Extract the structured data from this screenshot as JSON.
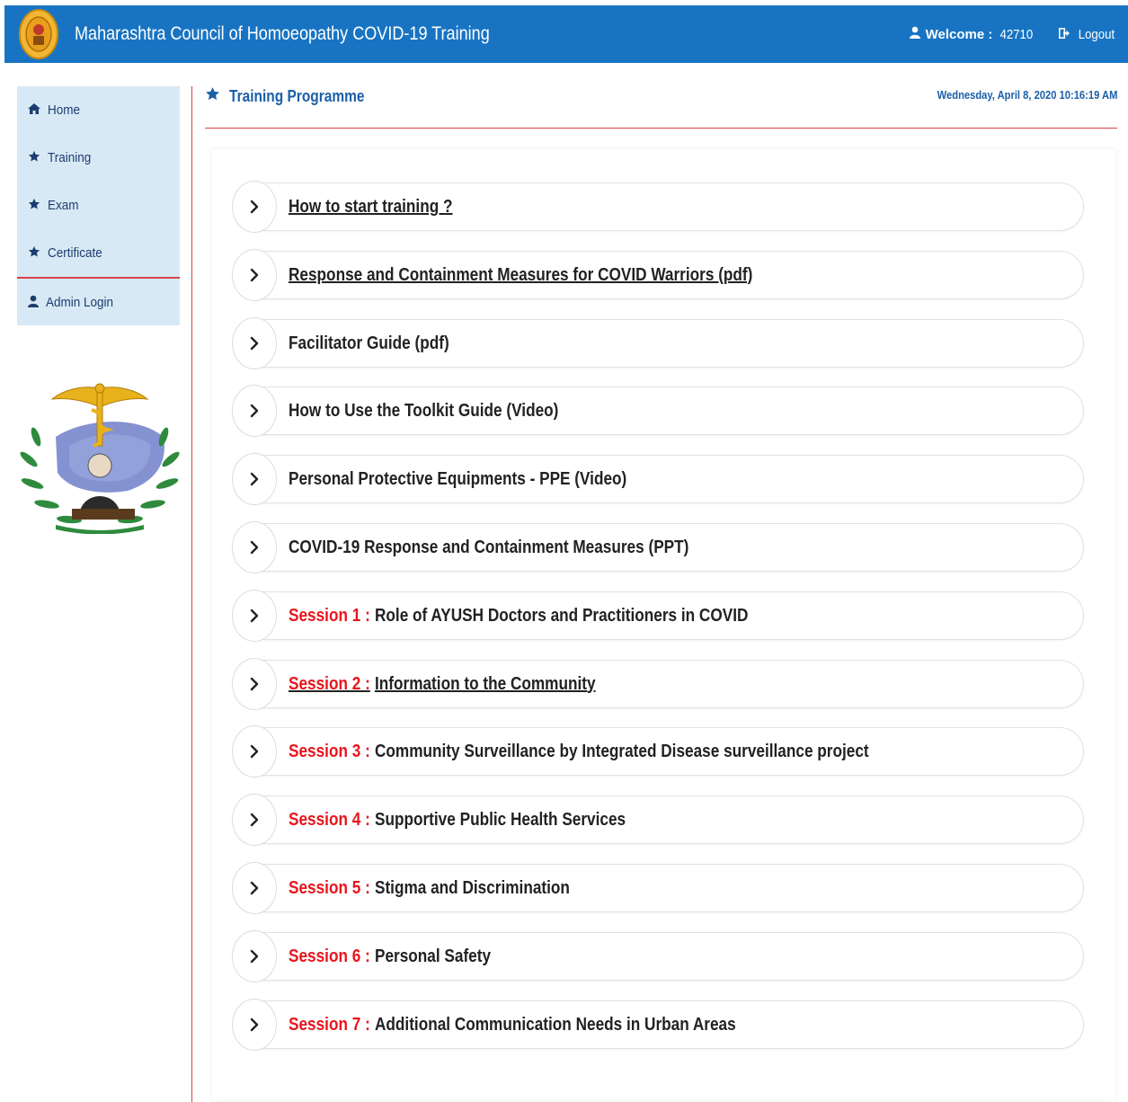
{
  "header": {
    "title": "Maharashtra Council of Homoeopathy COVID-19 Training",
    "welcome_label": "Welcome :",
    "welcome_value": "42710",
    "logout_label": "Logout"
  },
  "sidebar": {
    "items": [
      {
        "label": "Home",
        "icon": "home-icon"
      },
      {
        "label": "Training",
        "icon": "star-icon"
      },
      {
        "label": "Exam",
        "icon": "star-icon"
      },
      {
        "label": "Certificate",
        "icon": "star-icon"
      },
      {
        "label": "Admin Login",
        "icon": "user-icon"
      }
    ]
  },
  "page": {
    "title": "Training Programme",
    "datetime": "Wednesday, April 8, 2020 10:16:19 AM"
  },
  "programme": [
    {
      "session": "",
      "label": "How to start training ?"
    },
    {
      "session": "",
      "label": "Response and Containment Measures for COVID Warriors (pdf)"
    },
    {
      "session": "",
      "label": "Facilitator Guide (pdf)"
    },
    {
      "session": "",
      "label": "How to Use the Toolkit Guide (Video)"
    },
    {
      "session": "",
      "label": "Personal Protective Equipments - PPE (Video)"
    },
    {
      "session": "",
      "label": "COVID-19 Response and Containment Measures (PPT)"
    },
    {
      "session": "Session 1 :",
      "label": "Role of AYUSH Doctors and Practitioners in COVID"
    },
    {
      "session": "Session 2 :",
      "label": "Information to the Community"
    },
    {
      "session": "Session 3 :",
      "label": "Community Surveillance by Integrated Disease surveillance project"
    },
    {
      "session": "Session 4 :",
      "label": "Supportive Public Health Services"
    },
    {
      "session": "Session 5 :",
      "label": "Stigma and Discrimination"
    },
    {
      "session": "Session 6 :",
      "label": "Personal Safety"
    },
    {
      "session": "Session 7 :",
      "label": "Additional Communication Needs in Urban Areas"
    }
  ],
  "colors": {
    "header": "#1874c3",
    "sidebar": "#d8e9f6",
    "accent_red": "#e8151d",
    "link_blue": "#1b5fa8"
  }
}
